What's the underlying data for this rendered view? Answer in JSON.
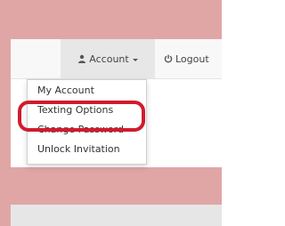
{
  "colors": {
    "surround": "#e0a6a6",
    "navbar_bg": "#f8f8f8",
    "active_nav_bg": "#e7e7e7",
    "highlight": "#d11b2e"
  },
  "navbar": {
    "account": {
      "icon": "user-icon",
      "label": "Account"
    },
    "logout": {
      "icon": "power-icon",
      "label": "Logout"
    }
  },
  "dropdown": {
    "items": [
      "My Account",
      "Texting Options",
      "Change Password",
      "Unlock Invitation"
    ],
    "highlighted_item": "Texting Options"
  }
}
